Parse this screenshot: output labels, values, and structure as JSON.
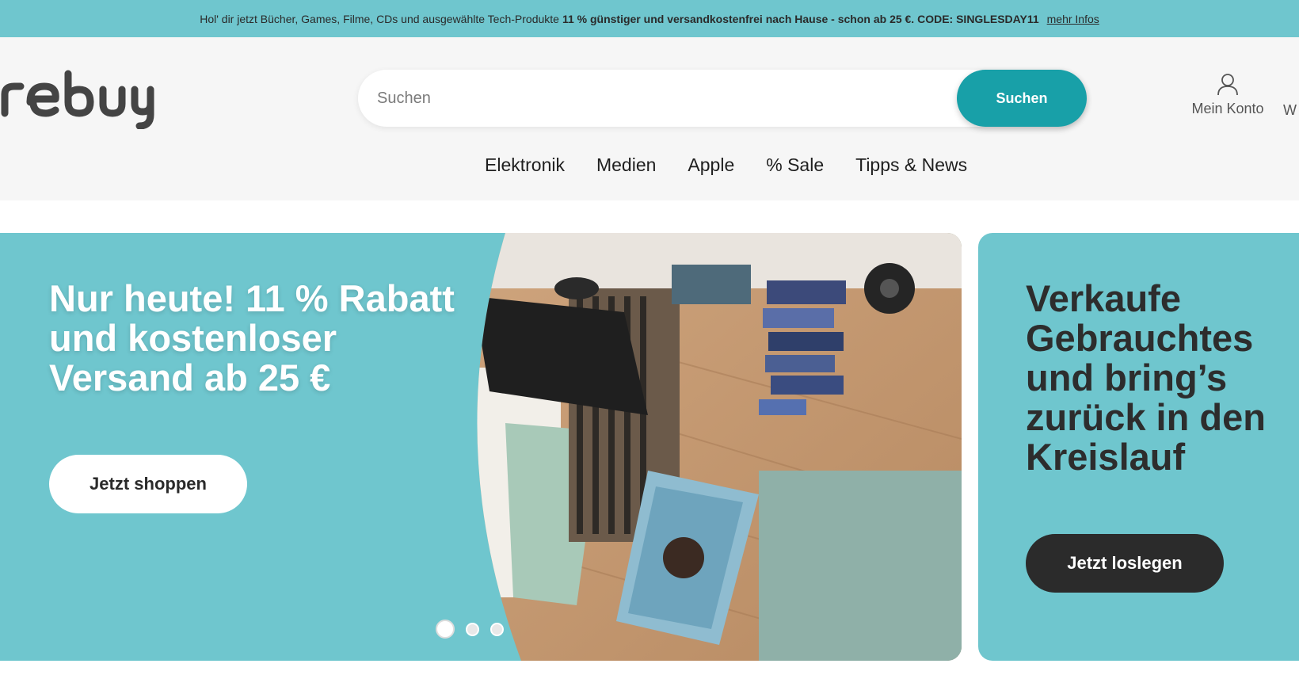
{
  "promo": {
    "text": "Hol' dir jetzt Bücher, Games, Filme, CDs und ausgewählte Tech-Produkte",
    "highlight": "11 % günstiger und versandkostenfrei nach Hause - schon ab 25 €. CODE: SINGLESDAY11",
    "link": "mehr Infos"
  },
  "header": {
    "logo_text": "rebuy",
    "search": {
      "placeholder": "Suchen",
      "button": "Suchen"
    },
    "account_label": "Mein Konto",
    "cut_label": "W"
  },
  "nav": [
    "Elektronik",
    "Medien",
    "Apple",
    "% Sale",
    "Tipps & News"
  ],
  "hero": {
    "title": "Nur heute! 11 % Rabatt und kostenloser Versand ab 25 €",
    "button": "Jetzt shoppen",
    "slides": 3,
    "active_slide": 1
  },
  "side_card": {
    "title": "Verkaufe Gebrauchtes und bring’s zurück in den Kreislauf",
    "button": "Jetzt loslegen"
  },
  "colors": {
    "teal": "#6fc6ce",
    "search_button": "#18a0a8",
    "dark_button": "#2b2b2b"
  }
}
